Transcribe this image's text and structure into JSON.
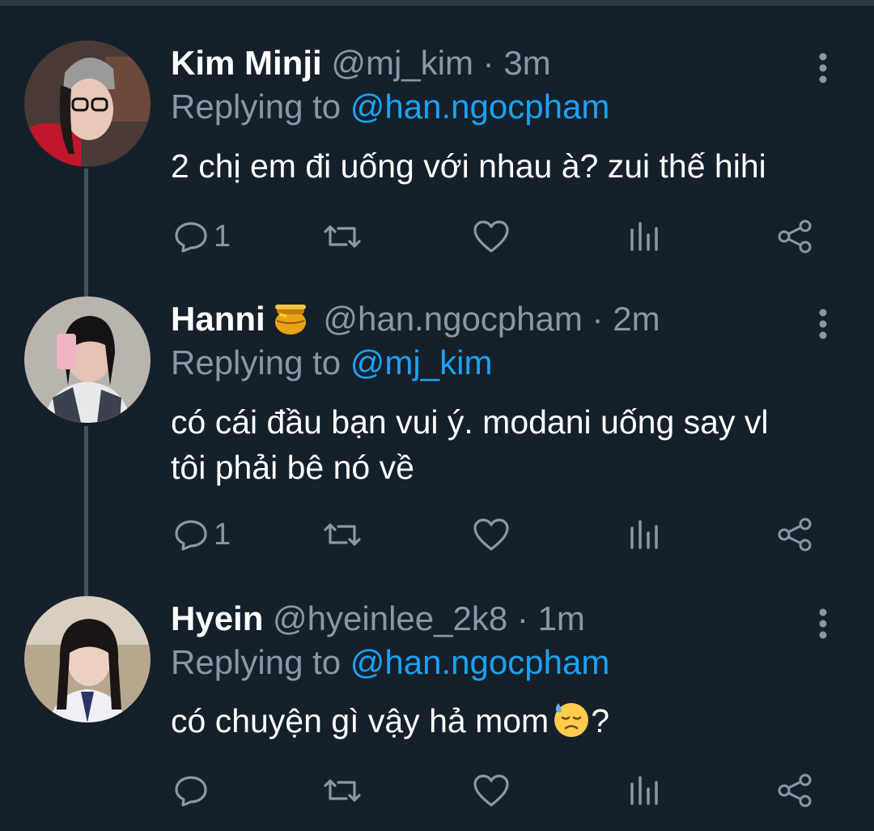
{
  "tweets": [
    {
      "name": "Kim Minji",
      "handle": "@mj_kim",
      "separator": "·",
      "time": "3m",
      "reply_prefix": "Replying to",
      "reply_to": "@han.ngocpham",
      "text": "2 chị em đi uống với nhau à? zui thế hihi",
      "reply_count": "1"
    },
    {
      "name": "Hanni",
      "name_emoji": "honey-pot-icon",
      "handle": "@han.ngocpham",
      "separator": "·",
      "time": "2m",
      "reply_prefix": "Replying to",
      "reply_to": "@mj_kim",
      "text_line1": "có cái đầu bạn vui ý. modani uống say vl",
      "text_line2": "tôi phải bê nó về",
      "reply_count": "1"
    },
    {
      "name": "Hyein",
      "handle": "@hyeinlee_2k8",
      "separator": "·",
      "time": "1m",
      "reply_prefix": "Replying to",
      "reply_to": "@han.ngocpham",
      "text": "có chuyện gì vậy hả mom",
      "text_suffix": "?",
      "text_emoji": "sad-sweat-face-icon",
      "reply_count": ""
    }
  ],
  "colors": {
    "background": "#15202b",
    "secondary_text": "#8899a6",
    "mention": "#1da1f2",
    "thread_line": "#3d5466"
  }
}
